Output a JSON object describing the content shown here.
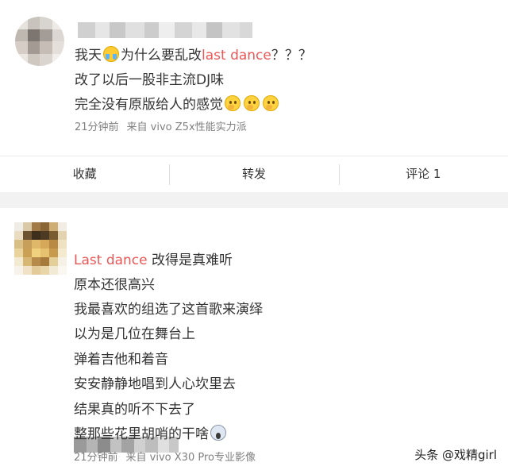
{
  "comments": [
    {
      "lines": {
        "l1_a": "我天",
        "l1_b": "为什么要乱改",
        "l1_hl": "last dance",
        "l1_c": "？？？",
        "l2": "改了以后一股非主流DJ味",
        "l3": "完全没有原版给人的感觉"
      },
      "time": "21分钟前",
      "source": "来自 vivo Z5x性能实力派",
      "emojis": [
        "crying-laugh-emoji",
        "thinking-emoji"
      ]
    },
    {
      "lines": {
        "l1_hl": "Last dance",
        "l1_b": " 改得是真难听",
        "l2": "原本还很高兴",
        "l3": "我最喜欢的组选了这首歌来演绎",
        "l4": "以为是几位在舞台上",
        "l5": "弹着吉他和着音",
        "l6": "安安静静地唱到人心坎里去",
        "l7": "结果真的听不下去了",
        "l8": "整那些花里胡哨的干啥"
      },
      "time": "21分钟前",
      "source": "来自 vivo X30 Pro专业影像",
      "emojis": [
        "scream-emoji"
      ]
    }
  ],
  "actions": {
    "favorite": "收藏",
    "repost": "转发",
    "comment": "评论 1"
  },
  "watermark": "头条 @戏精girl",
  "colors": {
    "highlight": "#eb5757",
    "meta": "#808080",
    "separator": "#f2f2f2"
  }
}
